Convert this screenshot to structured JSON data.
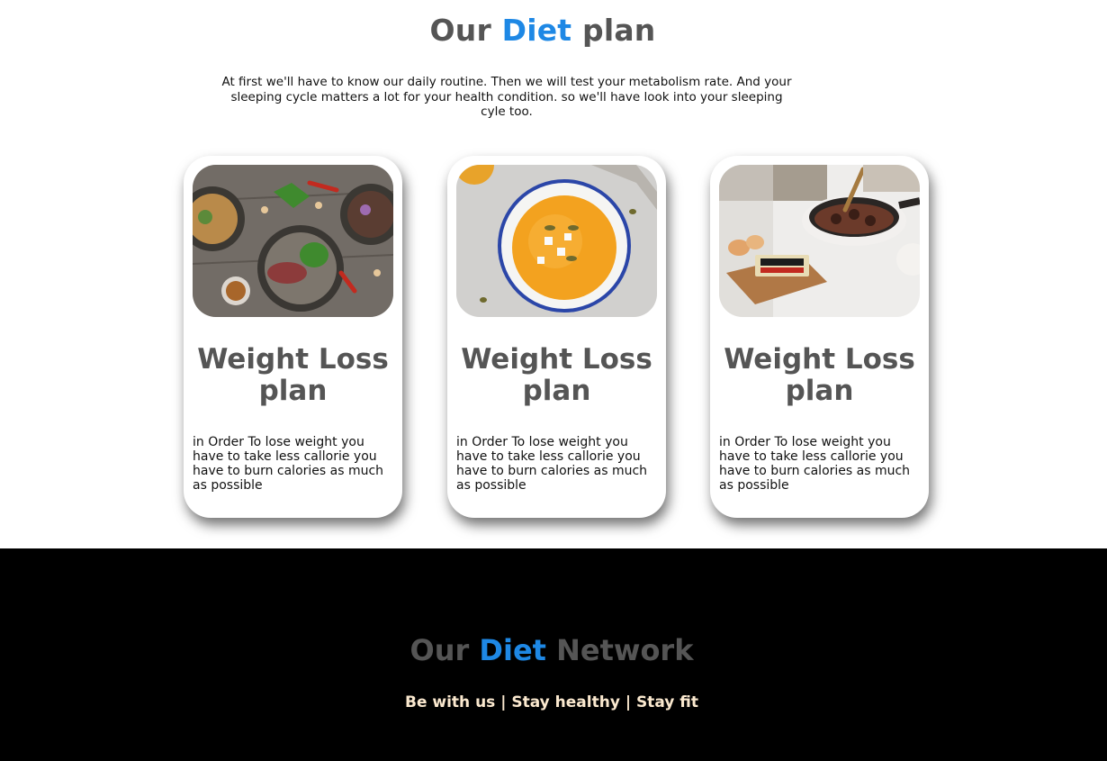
{
  "plan_section": {
    "title_before": "Our",
    "title_accent": "Diet",
    "title_after": "plan",
    "intro": "At first we'll have to know our daily routine. Then we will test your metabolism rate. And your sleeping cycle matters a lot for your health condition. so we'll have look into your sleeping cyle too."
  },
  "cards": [
    {
      "image": "food-bowls-photo",
      "title": "Weight Loss plan",
      "description": "in Order To lose weight you have to take less callorie you have to burn calories as much as possible"
    },
    {
      "image": "pumpkin-soup-photo",
      "title": "Weight Loss plan",
      "description": "in Order To lose weight you have to take less callorie you have to burn calories as much as possible"
    },
    {
      "image": "cooking-pan-photo",
      "title": "Weight Loss plan",
      "description": "in Order To lose weight you have to take less callorie you have to burn calories as much as possible"
    }
  ],
  "footer": {
    "title_before": "Our",
    "title_accent": "Diet",
    "title_after": "Network",
    "tagline": "Be with us | Stay healthy | Stay fit"
  },
  "colors": {
    "accent": "#1e88e5",
    "heading_gray": "#555555",
    "footer_bg": "#000000",
    "tagline": "#fbe9cf"
  }
}
